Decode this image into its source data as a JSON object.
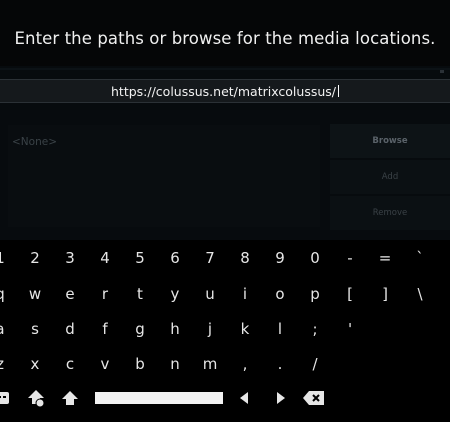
{
  "dialog": {
    "heading": "Enter the paths or browse for the media locations.",
    "input_value": "https://colussus.net/matrixcolussus/",
    "list_items": [
      "<None>"
    ],
    "buttons": {
      "browse": "Browse",
      "add": "Add",
      "remove": "Remove"
    }
  },
  "keyboard": {
    "rows": [
      [
        "1",
        "2",
        "3",
        "4",
        "5",
        "6",
        "7",
        "8",
        "9",
        "0",
        "-",
        "=",
        "`"
      ],
      [
        "q",
        "w",
        "e",
        "r",
        "t",
        "y",
        "u",
        "i",
        "o",
        "p",
        "[",
        "]",
        "\\"
      ],
      [
        "a",
        "s",
        "d",
        "f",
        "g",
        "h",
        "j",
        "k",
        "l",
        ";",
        "'"
      ],
      [
        "z",
        "x",
        "c",
        "v",
        "b",
        "n",
        "m",
        ",",
        ".",
        "/"
      ]
    ],
    "controls": [
      "shift-icon",
      "symbols-shift-icon",
      "caps-up-icon",
      "space-bar",
      "left-arrow-icon",
      "right-arrow-icon",
      "backspace-icon"
    ]
  },
  "colors": {
    "background": "#000000",
    "text": "#e8e8e8",
    "panel": "#070b0e",
    "input": "#15191c"
  }
}
